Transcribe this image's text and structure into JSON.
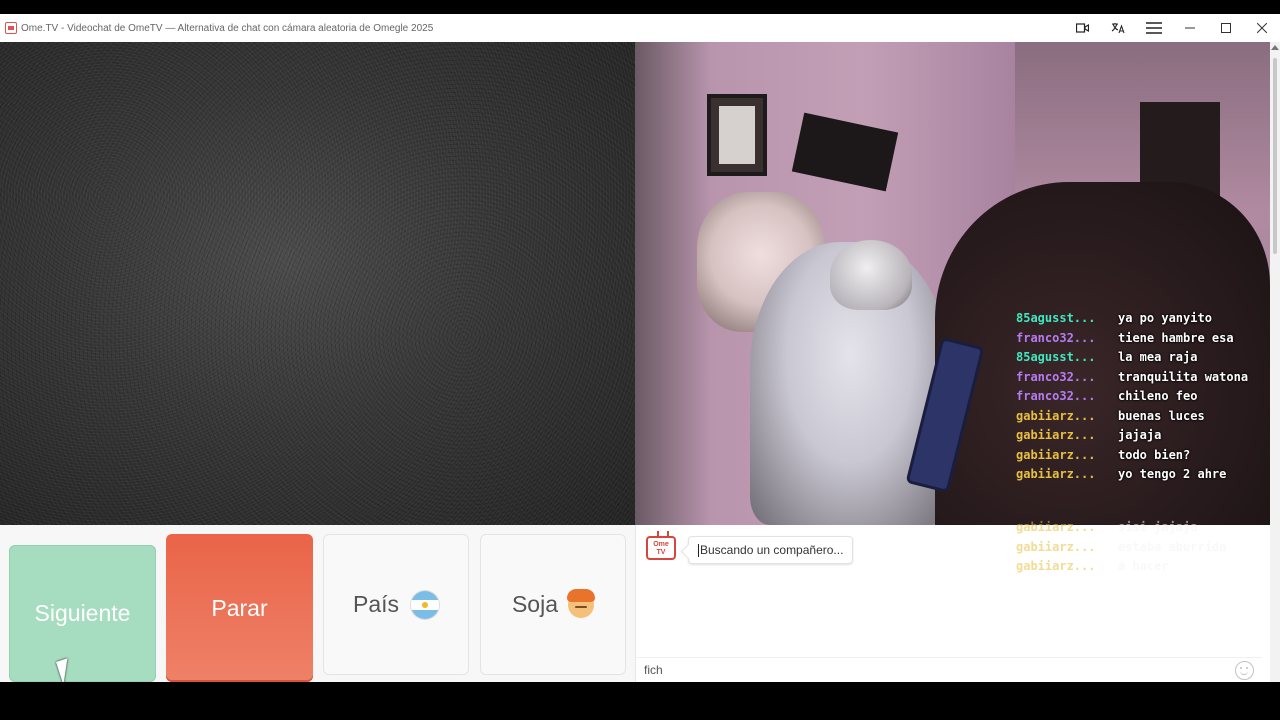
{
  "window": {
    "title": "Ome.TV - Videochat de OmeTV — Alternativa de chat con cámara aleatoria de Omegle 2025",
    "icons": [
      "camera-icon",
      "translate-icon",
      "menu-icon",
      "minimize-icon",
      "maximize-icon",
      "close-icon"
    ]
  },
  "controls": {
    "next_label": "Siguiente",
    "stop_label": "Parar",
    "country_label": "País",
    "gender_label": "Soja",
    "next_color": "#a6dcc0",
    "stop_color": "#ea6448"
  },
  "chat_panel": {
    "logo_text": "Ome TV",
    "status": "Buscando un compañero...",
    "input_value": "fich"
  },
  "overlay_chat": [
    {
      "user": "85agusst...",
      "message": "ya po yanyito",
      "color": "#3fe8c0"
    },
    {
      "user": "franco32...",
      "message": "tiene hambre esa",
      "color": "#b57cf2"
    },
    {
      "user": "85agusst...",
      "message": "la mea raja",
      "color": "#3fe8c0"
    },
    {
      "user": "franco32...",
      "message": "tranquilita watona",
      "color": "#b57cf2"
    },
    {
      "user": "franco32...",
      "message": "chileno feo",
      "color": "#b57cf2"
    },
    {
      "user": "gabiiarz...",
      "message": "buenas luces",
      "color": "#e8c040"
    },
    {
      "user": "gabiiarz...",
      "message": "jajaja",
      "color": "#e8c040"
    },
    {
      "user": "gabiiarz...",
      "message": "todo bien?",
      "color": "#e8c040"
    },
    {
      "user": "gabiiarz...",
      "message": "yo tengo 2 ahre",
      "color": "#e8c040"
    }
  ],
  "overlay_chat_faded": [
    {
      "user": "gabiiarz...",
      "message": "sisi jajaja",
      "color": "#e8c040"
    },
    {
      "user": "gabiiarz...",
      "message": "estaba aburrida",
      "color": "#e8c040"
    },
    {
      "user": "gabiiarz...",
      "message": "a hacer",
      "color": "#e8c040"
    }
  ]
}
